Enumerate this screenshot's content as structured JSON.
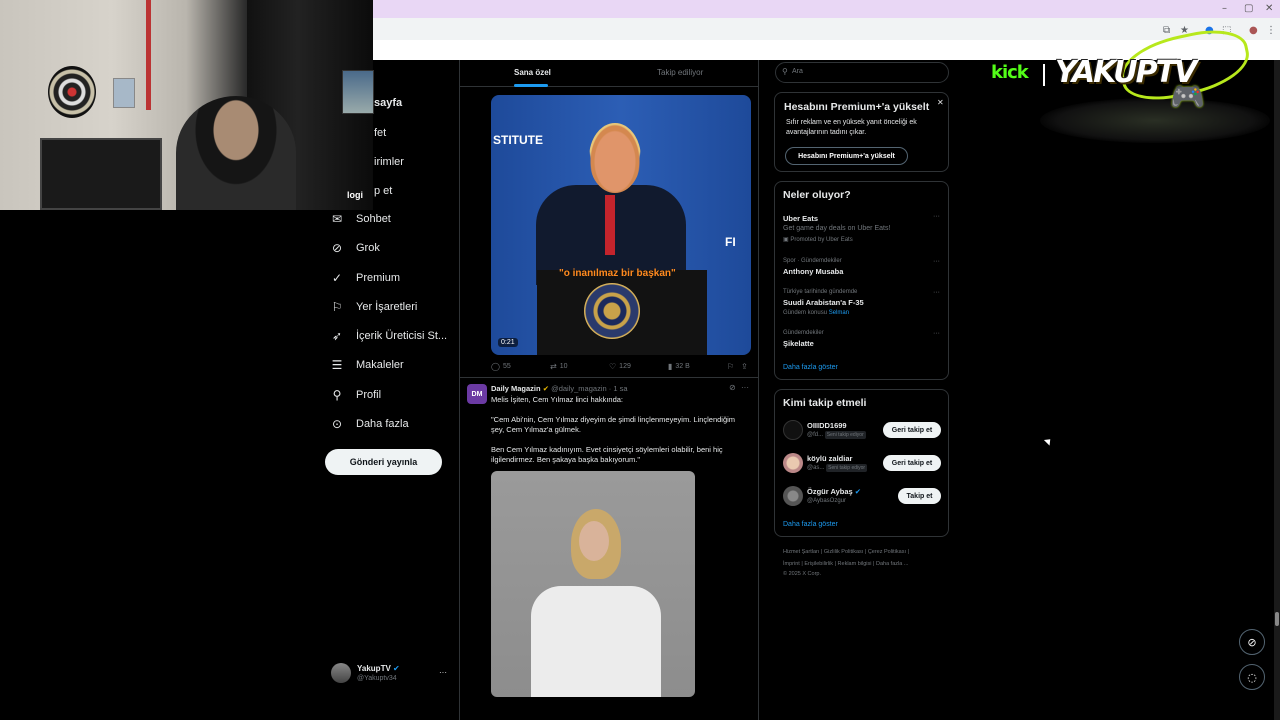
{
  "browser": {
    "window_controls": [
      "–",
      "▢",
      "✕"
    ],
    "toolbar_icons": [
      "share-icon",
      "star-icon",
      "extensions-icon",
      "profile-icon",
      "menu-icon"
    ]
  },
  "overlay": {
    "kick_label": "kick",
    "channel_name": "YAKUPTV",
    "webcam_text": "logi"
  },
  "nav": {
    "items": [
      {
        "label": "sayfa",
        "icon": "home-icon"
      },
      {
        "label": "fet",
        "icon": "search-icon"
      },
      {
        "label": "irimler",
        "icon": "bell-icon"
      },
      {
        "label": "p et",
        "icon": "users-icon"
      },
      {
        "label": "Sohbet",
        "icon": "mail-icon"
      },
      {
        "label": "Grok",
        "icon": "grok-icon"
      },
      {
        "label": "Premium",
        "icon": "premium-icon"
      },
      {
        "label": "Yer İşaretleri",
        "icon": "bookmark-icon"
      },
      {
        "label": "İçerik Üreticisi St...",
        "icon": "rocket-icon"
      },
      {
        "label": "Makaleler",
        "icon": "articles-icon"
      },
      {
        "label": "Profil",
        "icon": "person-icon"
      },
      {
        "label": "Daha fazla",
        "icon": "more-circle-icon"
      }
    ],
    "post_button": "Gönderi yayınla",
    "profile": {
      "name": "YakupTV",
      "handle": "@Yakuptv34",
      "more": "···"
    }
  },
  "feed": {
    "tabs": [
      "Sana özel",
      "Takip ediliyor"
    ],
    "active_tab": 0,
    "video_tweet": {
      "caption": "\"o inanılmaz bir başkan\"",
      "stage_text_left": "STITUTE",
      "stage_text_right": "FI",
      "duration": "0:21",
      "metrics": {
        "replies": "55",
        "reposts": "10",
        "likes": "129",
        "views": "32 B"
      }
    },
    "tweet": {
      "avatar_text": "DM",
      "author": "Daily Magazin",
      "handle_time": "@daily_magazin · 1 sa",
      "line1": "Melis İşiten, Cem Yılmaz linci hakkında:",
      "quote1a": "\"Cem Abi'nin, Cem Yılmaz diyeyim de şimdi linçlenmeyeyim. Linçlendiğim",
      "quote1b": "şey, Cem Yılmaz'a gülmek.",
      "quote2a": "Ben Cem Yılmaz kadınıyım. Evet cinsiyetçi söylemleri olabilir, beni hiç",
      "quote2b": "ilgilendirmez. Ben şakaya başka bakıyorum.\"",
      "more": "···"
    }
  },
  "sidebar": {
    "search_placeholder": "Ara",
    "premium": {
      "title": "Hesabını Premium+'a yükselt",
      "body1": "Sıfır reklam ve en yüksek yanıt önceliği ek",
      "body2": "avantajlarının tadını çıkar.",
      "button": "Hesabını Premium+'a yükselt",
      "close": "✕"
    },
    "trends": {
      "title": "Neler oluyor?",
      "items": [
        {
          "name": "Uber Eats",
          "sub": "Get game day deals on Uber Eats!",
          "meta": "Promoted by Uber Eats"
        },
        {
          "context": "Spor · Gündemdekiler",
          "name": "Anthony Musaba"
        },
        {
          "context": "Türkiye tarihinde gündemde",
          "name": "Suudi Arabistan'a F-35",
          "meta_prefix": "Gündem konusu ",
          "meta_link": "Selman"
        },
        {
          "context": "Gündemdekiler",
          "name": "Şikelatte"
        }
      ],
      "show_more": "Daha fazla göster"
    },
    "who_to_follow": {
      "title": "Kimi takip etmeli",
      "items": [
        {
          "name": "OIIIDD1699",
          "handle": "@fd...",
          "tag": "Seni takip ediyor",
          "button": "Geri takip et"
        },
        {
          "name": "köylü zaldiar",
          "handle": "@as...",
          "tag": "Seni takip ediyor",
          "button": "Geri takip et"
        },
        {
          "name": "Özgür Aybaş",
          "handle": "@AybasOzgur",
          "tag": "",
          "button": "Takip et"
        }
      ],
      "show_more": "Daha fazla göster"
    },
    "footer": {
      "line1": [
        "Hizmet Şartları",
        "Gizlilik Politikası",
        "Çerez Politikası"
      ],
      "line2": [
        "İmprint",
        "Erişilebilirlik",
        "Reklam bilgisi",
        "Daha fazla ..."
      ],
      "line3": "© 2025 X Corp."
    }
  },
  "colors": {
    "accent": "#1d9bf0",
    "kick_green": "#53fc18",
    "caption_orange": "#ff8a1e"
  }
}
